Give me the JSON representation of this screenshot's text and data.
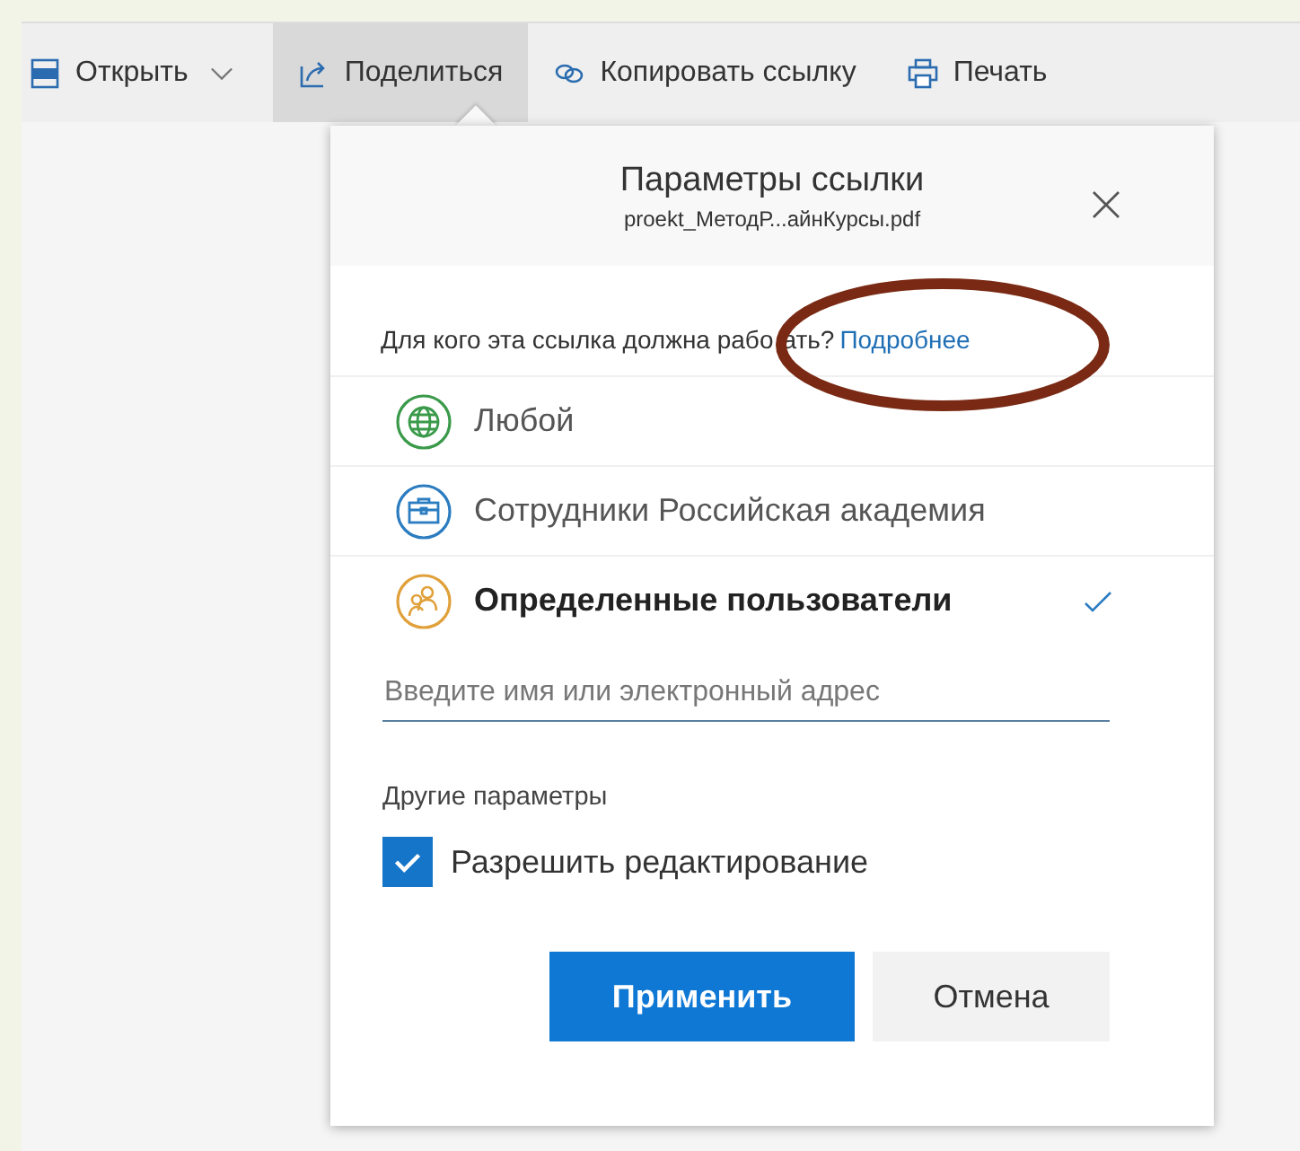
{
  "toolbar": [
    {
      "kind": "pdf",
      "label": "Открыть",
      "has_menu": true,
      "selected": false
    },
    {
      "kind": "share",
      "label": "Поделиться",
      "has_menu": false,
      "selected": true
    },
    {
      "kind": "link",
      "label": "Копировать ссылку",
      "has_menu": false,
      "selected": false
    },
    {
      "kind": "print",
      "label": "Печать",
      "has_menu": false,
      "selected": false
    }
  ],
  "dialog": {
    "title": "Параметры ссылки",
    "filename": "proekt_МетодР...айнКурсы.pdf",
    "question": "Для кого эта ссылка должна рабо",
    "question_end": "ать?",
    "learn_more": "Подробнее",
    "options": [
      {
        "kind": "globe",
        "label": "Любой",
        "color": "#3a9a4a",
        "selected": false
      },
      {
        "kind": "briefcase",
        "label": "Сотрудники Российская академия",
        "color": "#2b7cc0",
        "selected": false
      },
      {
        "kind": "people",
        "label": "Определенные пользователи",
        "color": "#e0a03a",
        "selected": true
      }
    ],
    "recipient": {
      "placeholder": "Введите имя или электронный адрес"
    },
    "other_heading": "Другие параметры",
    "allow_edit": {
      "label": "Разрешить редактирование",
      "checked": true
    },
    "buttons": [
      {
        "kind": "primary",
        "label": "Применить"
      },
      {
        "kind": "secondary",
        "label": "Отмена"
      }
    ]
  }
}
